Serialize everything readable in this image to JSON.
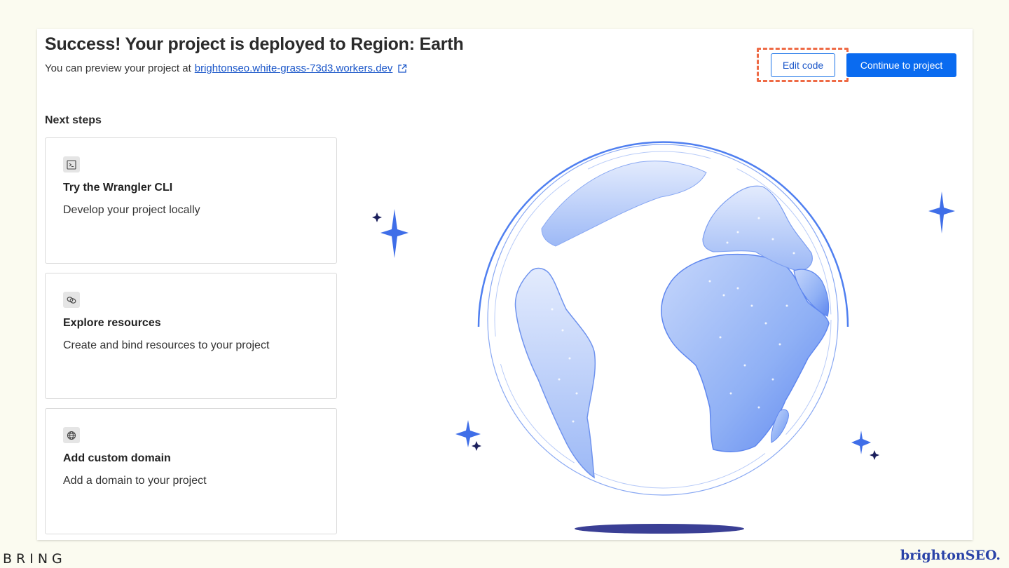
{
  "header": {
    "title": "Success! Your project is deployed to Region: Earth",
    "preview_text": "You can preview your project at",
    "preview_link": "brightonseo.white-grass-73d3.workers.dev"
  },
  "actions": {
    "edit_code": "Edit code",
    "continue": "Continue to project"
  },
  "next_steps": {
    "heading": "Next steps",
    "cards": [
      {
        "icon": "terminal-icon",
        "title": "Try the Wrangler CLI",
        "description": "Develop your project locally"
      },
      {
        "icon": "link-icon",
        "title": "Explore resources",
        "description": "Create and bind resources to your project"
      },
      {
        "icon": "globe-icon",
        "title": "Add custom domain",
        "description": "Add a domain to your project"
      }
    ]
  },
  "footer": {
    "left_brand": "BRING",
    "right_brand": "brightonSEO."
  },
  "colors": {
    "accent": "#0a6bf0",
    "highlight": "#ee6a45",
    "globe_blue": "#4f7ff0",
    "dark_star": "#1b1f5c"
  }
}
